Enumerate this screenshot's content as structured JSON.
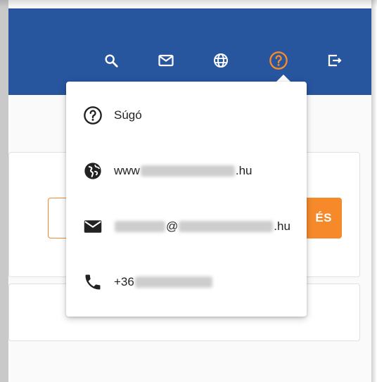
{
  "colors": {
    "topbar": "#27559e",
    "accent_orange": "#f68a2b",
    "icon_white": "#ffffff",
    "text_dark": "#222222"
  },
  "topbar": {
    "icons": [
      "search-icon",
      "mail-icon",
      "globe-icon",
      "help-icon",
      "logout-icon"
    ],
    "active_icon": "help-icon"
  },
  "page": {
    "orange_button_label": "ÉS"
  },
  "help_menu": {
    "items": [
      {
        "icon": "help-circle-icon",
        "label": "Súgó"
      },
      {
        "icon": "globe-icon",
        "prefix": "www",
        "suffix": ".hu"
      },
      {
        "icon": "mail-icon",
        "at": "@",
        "suffix": ".hu"
      },
      {
        "icon": "phone-icon",
        "prefix": "+36"
      }
    ]
  }
}
